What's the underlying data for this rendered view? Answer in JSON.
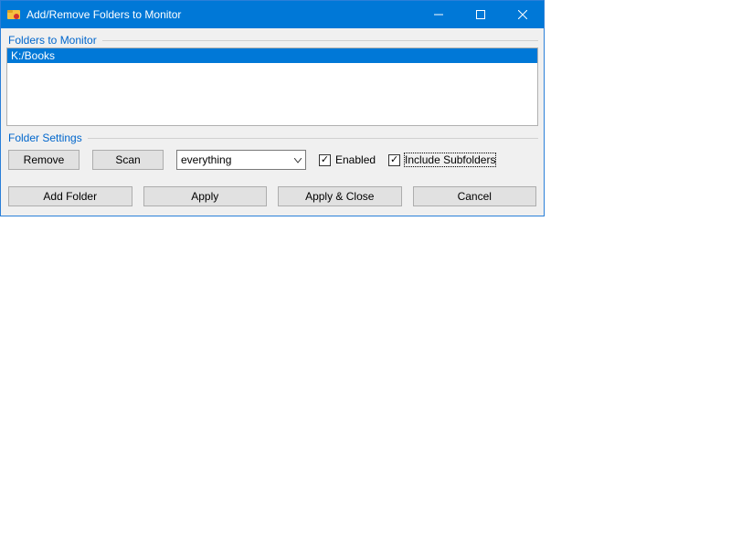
{
  "window": {
    "title": "Add/Remove Folders to Monitor"
  },
  "groups": {
    "folders_label": "Folders to Monitor",
    "settings_label": "Folder Settings"
  },
  "folders": {
    "items": [
      {
        "path": "K:/Books"
      }
    ]
  },
  "settings": {
    "remove_label": "Remove",
    "scan_label": "Scan",
    "filter_value": "everything",
    "enabled_label": "Enabled",
    "enabled_checked": "✓",
    "subfolders_label": "Include Subfolders",
    "subfolders_checked": "✓"
  },
  "actions": {
    "add_label": "Add Folder",
    "apply_label": "Apply",
    "apply_close_label": "Apply & Close",
    "cancel_label": "Cancel"
  }
}
